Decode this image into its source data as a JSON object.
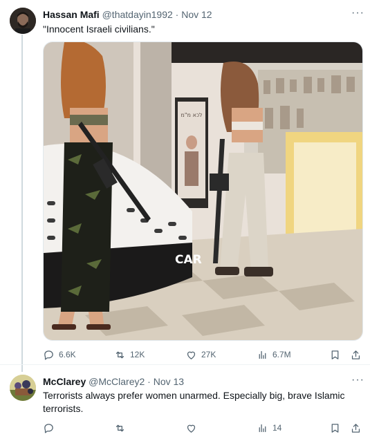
{
  "tweets": [
    {
      "author_name": "Hassan Mafi",
      "handle": "@thatdayin1992",
      "dot": "·",
      "date": "Nov 12",
      "more": "···",
      "text": "\"Innocent Israeli civilians.\"",
      "media": {
        "type": "photo",
        "store_sign": "CAR",
        "display_text_1": "לכא מ\"מ"
      },
      "stats": {
        "reply": "6.6K",
        "repost": "12K",
        "like": "27K",
        "views": "6.7M"
      }
    },
    {
      "author_name": "McClarey",
      "handle": "@McClarey2",
      "dot": "·",
      "date": "Nov 13",
      "more": "···",
      "text_line1": "Terrorists always prefer women unarmed.  Especially big, brave Islamic",
      "text_line2": "terrorists.",
      "stats": {
        "reply": "",
        "repost": "",
        "like": "",
        "views": "14"
      }
    }
  ],
  "icons": [
    "reply-icon",
    "repost-icon",
    "like-icon",
    "views-icon",
    "bookmark-icon",
    "share-icon"
  ],
  "colors": {
    "muted": "#536471",
    "text": "#0f1419",
    "thread_line": "#cfd9de"
  }
}
